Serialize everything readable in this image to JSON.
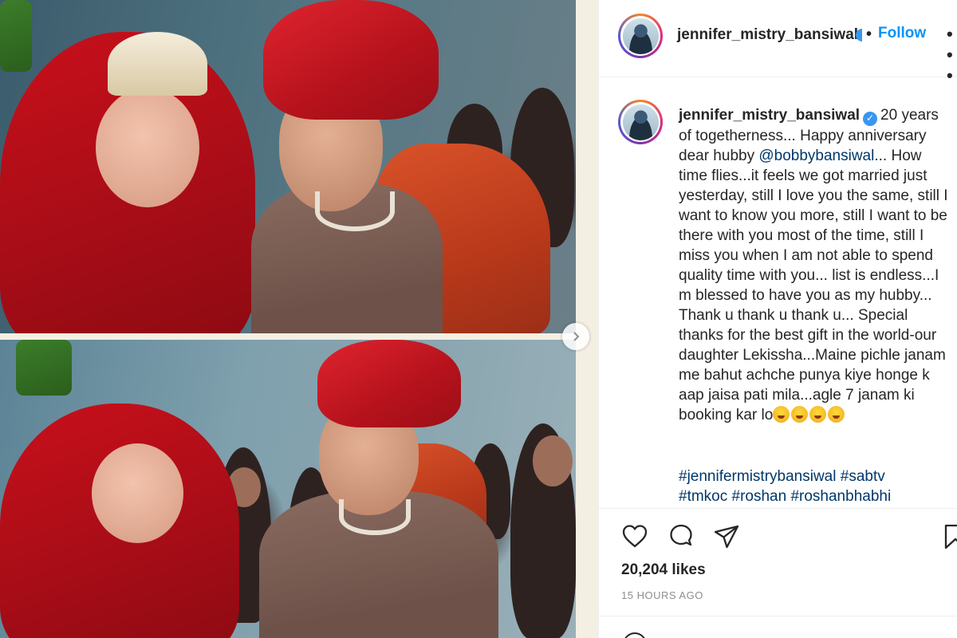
{
  "post": {
    "username": "jennifer_mistry_bansiwal",
    "follow_label": "Follow",
    "separator": "•",
    "more_label": "• • •",
    "caption": {
      "username": "jennifer_mistry_bansiwal",
      "text_before_mention": "20 years of togetherness... Happy anniversary dear hubby ",
      "mention": "@bobbybansiwal",
      "text_after_mention": "... How time flies...it feels we got married just yesterday, still I love you the same, still I want to know you more, still I want to be there with you most of the time, still I miss you when I am not able to spend quality time with you... list is endless...I m blessed to have you as my hubby... Thank u thank u thank u... Special thanks for the best gift in the world-our daughter Lekissha...Maine pichle janam me bahut achche punya kiye honge k aap jaisa pati mila...agle 7 janam ki booking kar lo",
      "emojis": [
        "yum-emoji",
        "tongue-emoji",
        "smile-emoji",
        "joy-emoji"
      ],
      "hashtags_line1": "#jennifermistrybansiwal #sabtv",
      "hashtags_line2": "#tmkoc #roshan #roshanbhabhi"
    },
    "likes": "20,204 likes",
    "timestamp": "15 HOURS AGO",
    "icons": {
      "like": "heart-icon",
      "comment": "comment-icon",
      "share": "paper-plane-icon",
      "save": "bookmark-icon",
      "carousel": "chevron-right-icon",
      "verified": "verified-badge-icon"
    }
  },
  "colors": {
    "link": "#0095f6",
    "mention": "#00376b",
    "verified": "#3897f0",
    "text": "#262626",
    "muted": "#8e8e8e"
  }
}
